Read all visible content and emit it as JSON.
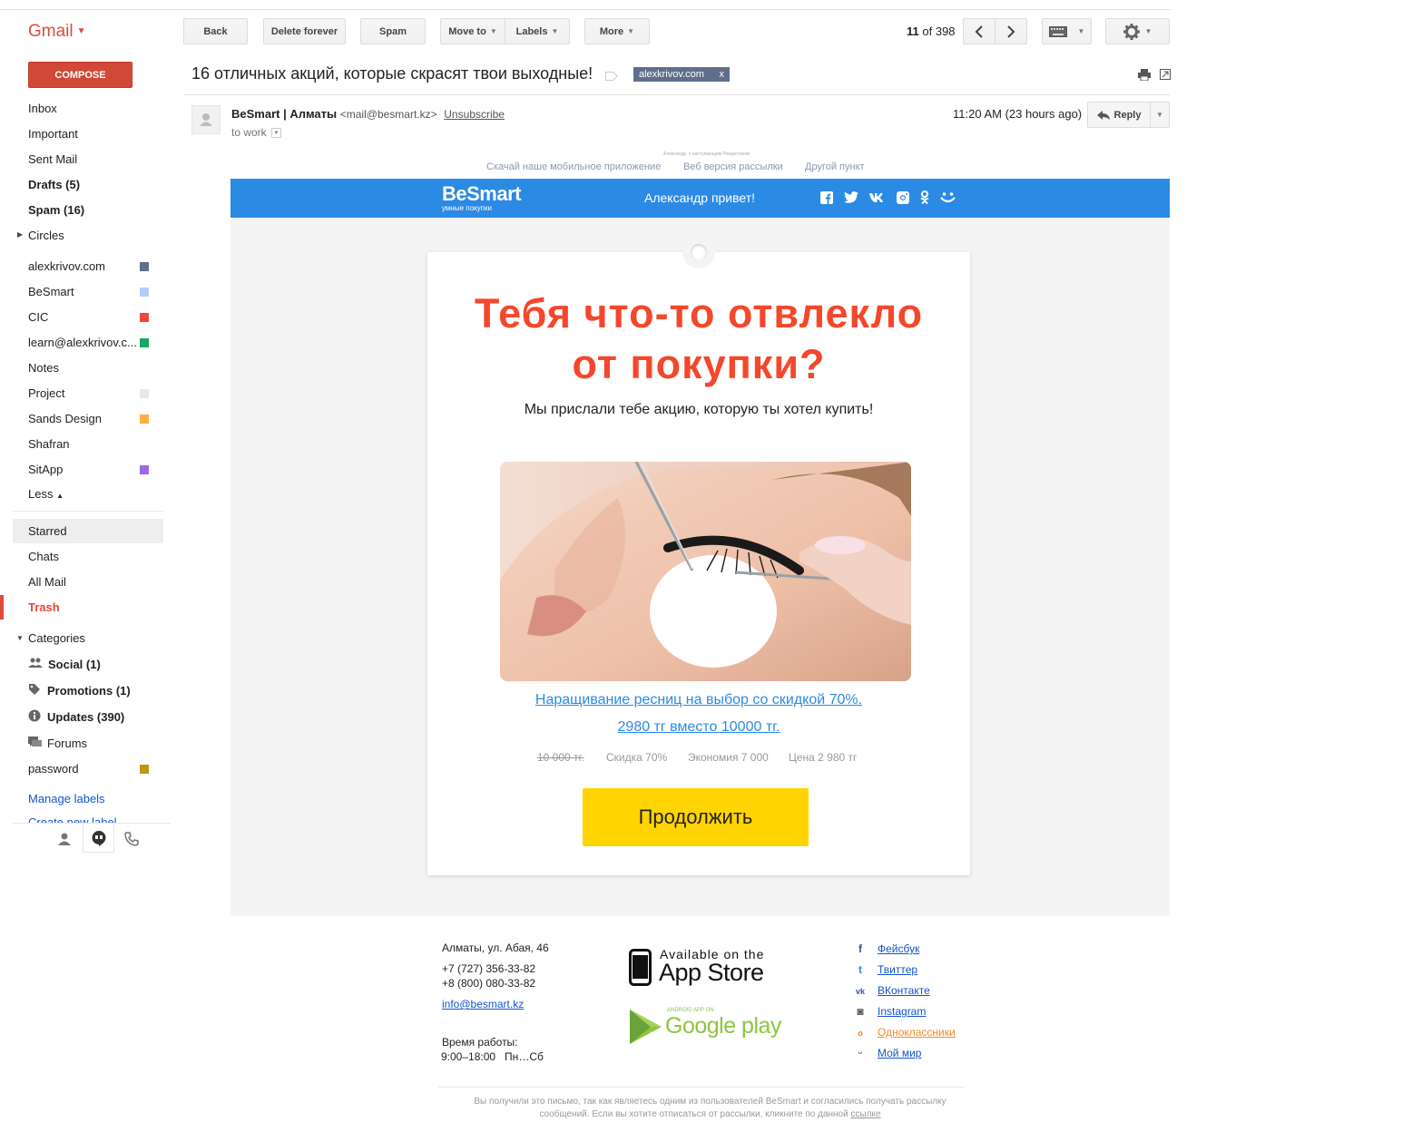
{
  "app": {
    "title": "Gmail"
  },
  "toolbar": {
    "back": "Back",
    "delete_forever": "Delete forever",
    "spam": "Spam",
    "move_to": "Move to",
    "labels": "Labels",
    "more": "More",
    "pager_current": "11",
    "pager_of": "of",
    "pager_total": "398"
  },
  "sidebar": {
    "compose": "COMPOSE",
    "items": [
      {
        "label": "Inbox"
      },
      {
        "label": "Important"
      },
      {
        "label": "Sent Mail"
      },
      {
        "label": "Drafts (5)"
      },
      {
        "label": "Spam (16)"
      },
      {
        "label": "Circles"
      }
    ],
    "labels": [
      {
        "label": "alexkrivov.com",
        "color": "#5f6f8b"
      },
      {
        "label": "BeSmart",
        "color": "#b3cefb"
      },
      {
        "label": "CIC",
        "color": "#f24738"
      },
      {
        "label": "learn@alexkrivov.c...",
        "color": "#16a765"
      },
      {
        "label": "Notes",
        "color": ""
      },
      {
        "label": "Project",
        "color": "#e8e8e8"
      },
      {
        "label": "Sands Design",
        "color": "#ffad46"
      },
      {
        "label": "Shafran",
        "color": ""
      },
      {
        "label": "SitApp",
        "color": "#9a6ce0"
      }
    ],
    "less": "Less",
    "more_items": [
      {
        "label": "Starred"
      },
      {
        "label": "Chats"
      },
      {
        "label": "All Mail"
      },
      {
        "label": "Trash"
      }
    ],
    "categories_label": "Categories",
    "categories": [
      {
        "label": "Social (1)"
      },
      {
        "label": "Promotions (1)"
      },
      {
        "label": "Updates (390)"
      },
      {
        "label": "Forums"
      }
    ],
    "password": {
      "label": "password",
      "color": "#b99a08"
    },
    "manage_labels": "Manage labels",
    "create_label": "Create new label"
  },
  "message": {
    "subject": "16 отличных акций, которые скрасят твои выходные!",
    "label_chip": "alexkrivov.com",
    "label_chip_close": "x",
    "sender_name": "BeSmart | Алматы",
    "sender_email": "<mail@besmart.kz>",
    "unsubscribe": "Unsubscribe",
    "to": "to work",
    "time": "11:20 AM (23 hours ago)",
    "reply": "Reply"
  },
  "email": {
    "preheader_tiny": "Александр, с наступающим Рождеством!",
    "preheader_links": [
      "Скачай наше мобильное приложение",
      "Веб версия рассылки",
      "Другой пункт"
    ],
    "brand": "BeSmart",
    "brand_tagline": "умные покупки",
    "greeting": "Александр привет!",
    "headline_line1": "Тебя что-то отвлекло",
    "headline_line2": "от покупки?",
    "subline": "Мы прислали тебе акцию, которую ты хотел купить!",
    "offer_line1": "Наращивание ресниц на выбор со скидкой 70%.",
    "offer_line2": "2980 тг вместо 10000 тг.",
    "stats": {
      "old_price": "10 000 тг.",
      "discount": "Скидка 70%",
      "savings": "Экономия 7 000",
      "price": "Цена 2 980 тг"
    },
    "cta": "Продолжить",
    "footer": {
      "address": "Алматы, ул. Абая, 46",
      "phone1": "+7 (727) 356-33-82",
      "phone2": "+8 (800) 080-33-82",
      "email": "info@besmart.kz",
      "hours_label": "Время работы:",
      "hours": "9:00–18:00   Пн…Сб",
      "appstore_small": "Available on the",
      "appstore_big": "App Store",
      "gplay_small": "ANDROID APP ON",
      "gplay_big": "Google play",
      "social": [
        "Фейсбук",
        "Твиттер",
        "ВКонтакте",
        "Instagram",
        "Одноклассники",
        "Мой мир"
      ],
      "disclaimer": "Вы получили это письмо, так как являетесь одним из пользователей BeSmart и согласились получать рассылку сообщений. Если вы хотите отписаться от рассылки, кликните по данной",
      "disclaimer_link": "ссылке"
    }
  }
}
